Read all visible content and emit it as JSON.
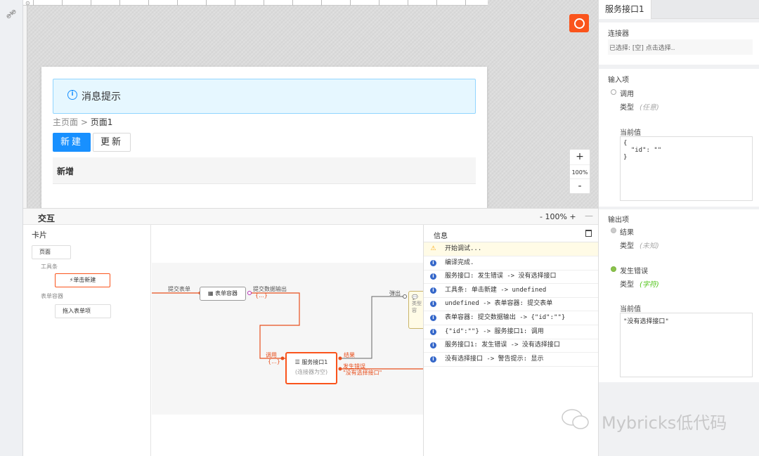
{
  "canvas": {
    "alert_text": "消息提示",
    "breadcrumb_home": "主页面",
    "breadcrumb_sep": " > ",
    "breadcrumb_current": "页面1",
    "btn_new": "新建",
    "btn_update": "更新",
    "section_title": "新增",
    "zoom_in": "+",
    "zoom_level": "100%",
    "zoom_out": "-"
  },
  "interaction": {
    "title": "交互",
    "zoom": "- 100% +",
    "minimize": "—",
    "tree": {
      "title": "卡片",
      "page": "页面",
      "group_toolbar": "工具条",
      "click_new": "单击新建",
      "group_form": "表单容器",
      "drag_in": "拖入表单项"
    },
    "graph": {
      "submit_form": "提交表单",
      "form_container": "表单容器",
      "submit_output": "提交数据输出",
      "submit_output_val": "{...}",
      "call": "调用",
      "call_val": "{...}",
      "service_name": "服务接口1",
      "service_sub": "(连接器为空)",
      "result": "结果",
      "error": "发生错误",
      "error_val": "\"没有选择接口\"",
      "popup": "弹出",
      "partial_node": "类型 内容"
    }
  },
  "info": {
    "title": "信息",
    "logs": [
      {
        "type": "warn",
        "text": "开始调试..."
      },
      {
        "type": "info",
        "text": "编译完成."
      },
      {
        "type": "info",
        "text": "服务接口: 发生错误 -> 没有选择接口"
      },
      {
        "type": "info",
        "text": "工具条: 单击新建 -> undefined"
      },
      {
        "type": "info",
        "text": "undefined -> 表单容器: 提交表单"
      },
      {
        "type": "info",
        "text": "表单容器: 提交数据输出 -> {\"id\":\"\"}"
      },
      {
        "type": "info",
        "text": "{\"id\":\"\"} -> 服务接口1: 调用"
      },
      {
        "type": "info",
        "text": "服务接口1: 发生错误 -> 没有选择接口"
      },
      {
        "type": "info",
        "text": "没有选择接口 -> 警告提示: 显示"
      }
    ]
  },
  "right_panel": {
    "tab": "服务接口1",
    "connector_label": "连接器",
    "connector_value": "已选择: [空] 点击选择..",
    "inputs_label": "输入项",
    "input_call": "调用",
    "type_label": "类型",
    "type_any": "(任意)",
    "current_value_label": "当前值",
    "input_value": "{\n  \"id\": \"\"\n}",
    "outputs_label": "输出项",
    "output_result": "结果",
    "type_unknown": "(未知)",
    "output_error": "发生错误",
    "type_string": "(字符)",
    "error_value": "\"没有选择接口\"",
    "accent": "#fa541c",
    "success": "#52c41a"
  },
  "watermark": "Mybricks低代码"
}
